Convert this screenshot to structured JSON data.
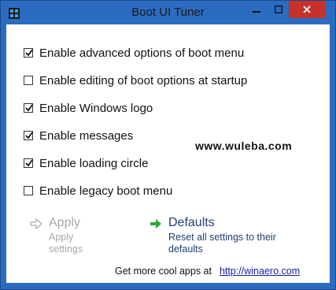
{
  "window": {
    "title": "Boot UI Tuner"
  },
  "options": [
    {
      "label": "Enable advanced options of boot menu",
      "checked": true
    },
    {
      "label": "Enable editing of boot options at startup",
      "checked": false
    },
    {
      "label": "Enable Windows logo",
      "checked": true
    },
    {
      "label": "Enable messages",
      "checked": true
    },
    {
      "label": "Enable loading circle",
      "checked": true
    },
    {
      "label": "Enable legacy boot menu",
      "checked": false
    }
  ],
  "watermark": "www.wuleba.com",
  "apply": {
    "title": "Apply",
    "description": "Apply settings",
    "enabled": false
  },
  "defaults": {
    "title": "Defaults",
    "description": "Reset all settings to their defaults"
  },
  "footer": {
    "text": "Get more cool apps at",
    "link": "http://winaero.com"
  },
  "colors": {
    "titlebar": "#2b6cc0",
    "close": "#c7312b",
    "link": "#1f3f74",
    "arrow": "#2fa83a"
  }
}
